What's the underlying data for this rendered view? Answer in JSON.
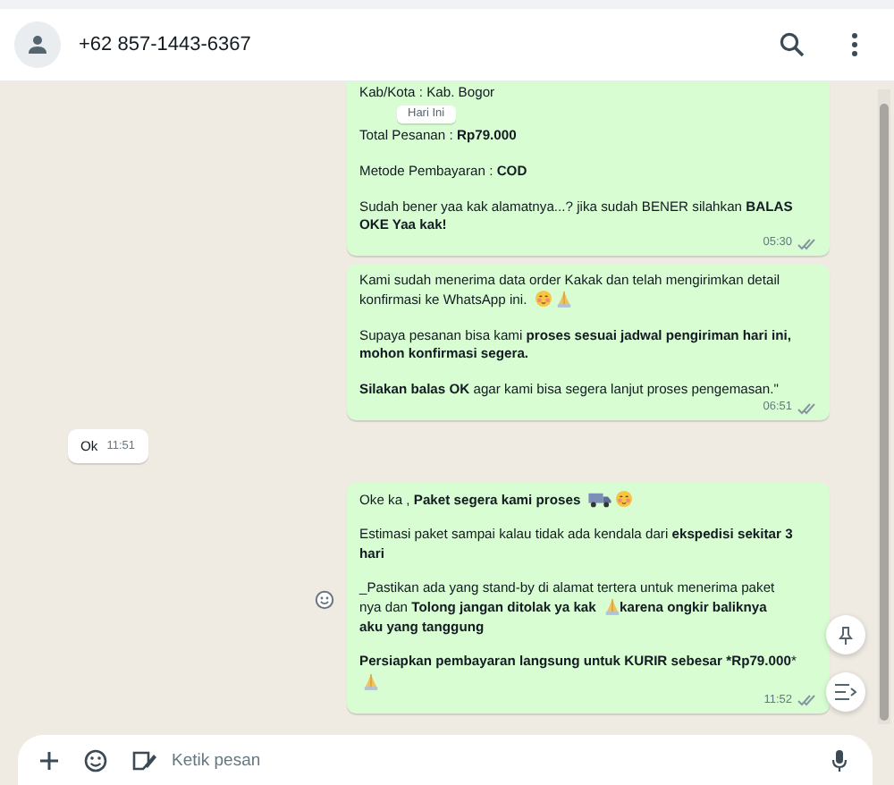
{
  "header": {
    "contact": "+62 857-1443-6367"
  },
  "date_chip": "Hari Ini",
  "messages": [
    {
      "kind": "outgoing",
      "time": "05:30",
      "reaction_button": false,
      "paragraphs": [
        [
          {
            "kind": "text",
            "text": "Kab/Kota : Kab. Bogor"
          }
        ],
        [
          {
            "kind": "text",
            "text": "Total Pesanan : **Rp79.000**"
          }
        ],
        [
          {
            "kind": "text",
            "text": "Metode Pembayaran : **COD**"
          }
        ],
        [
          {
            "kind": "text",
            "text": "Sudah bener yaa kak alamatnya...?  jika sudah BENER silahkan **BALAS OKE Yaa kak!**"
          }
        ]
      ]
    },
    {
      "kind": "outgoing",
      "time": "06:51",
      "reaction_button": false,
      "paragraphs": [
        [
          {
            "kind": "text",
            "text": "Kami sudah menerima data order Kakak dan telah mengirimkan detail"
          },
          {
            "kind": "text",
            "text": "konfirmasi ke WhatsApp ini."
          },
          {
            "kind": "blush"
          },
          {
            "kind": "pray"
          }
        ],
        [
          {
            "kind": "text",
            "text": "Supaya pesanan bisa kami **proses sesuai jadwal pengiriman hari ini, mohon konfirmasi segera.**"
          }
        ],
        [
          {
            "kind": "text",
            "text": "**Silakan balas OK** agar kami bisa segera lanjut proses pengemasan.\""
          }
        ]
      ]
    },
    {
      "kind": "incoming",
      "time": "11:51",
      "reaction_button": false,
      "paragraphs": [
        [
          {
            "kind": "text",
            "text": "Ok"
          }
        ]
      ]
    },
    {
      "kind": "outgoing",
      "time": "11:52",
      "reaction_button": true,
      "paragraphs": [
        [
          {
            "kind": "text",
            "text": "Oke ka , **Paket segera kami proses**"
          },
          {
            "kind": "truck"
          },
          {
            "kind": "blush"
          }
        ],
        [
          {
            "kind": "text",
            "text": "Estimasi paket sampai kalau tidak ada kendala dari **ekspedisi sekitar 3 hari**"
          }
        ],
        [
          {
            "kind": "text",
            "text": "_Pastikan ada yang stand-by di alamat tertera untuk menerima paket"
          },
          {
            "kind": "text",
            "text": "nya dan **Tolong jangan ditolak ya kak**"
          },
          {
            "kind": "pray"
          },
          {
            "kind": "text",
            "text": "**karena ongkir baliknya**"
          },
          {
            "kind": "text",
            "text": "**aku yang tanggung**"
          }
        ],
        [
          {
            "kind": "text",
            "text": "**Persiapkan pembayaran langsung untuk KURIR sebesar**"
          },
          {
            "kind": "text",
            "text": "***Rp79.000***"
          },
          {
            "kind": "pray"
          }
        ]
      ]
    }
  ],
  "composer": {
    "placeholder": "Ketik pesan"
  }
}
